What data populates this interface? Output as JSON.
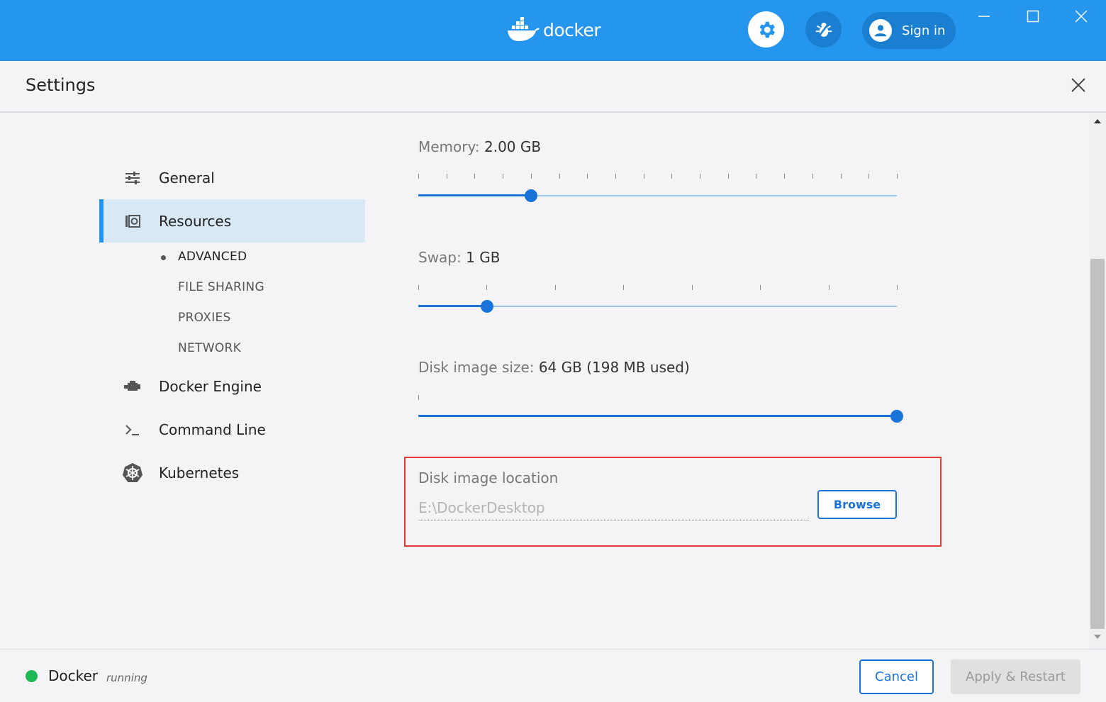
{
  "titlebar": {
    "brand": "docker",
    "signin_label": "Sign in",
    "accent_color": "#2496ed"
  },
  "settings": {
    "title": "Settings"
  },
  "sidebar": {
    "items": [
      {
        "label": "General",
        "icon": "sliders-icon"
      },
      {
        "label": "Resources",
        "icon": "resources-icon",
        "active": true
      },
      {
        "label": "Docker Engine",
        "icon": "engine-icon"
      },
      {
        "label": "Command Line",
        "icon": "terminal-icon"
      },
      {
        "label": "Kubernetes",
        "icon": "kubernetes-icon"
      }
    ],
    "subitems": [
      {
        "label": "ADVANCED",
        "active": true
      },
      {
        "label": "FILE SHARING"
      },
      {
        "label": "PROXIES"
      },
      {
        "label": "NETWORK"
      }
    ]
  },
  "resources": {
    "memory": {
      "label": "Memory: ",
      "value": "2.00 GB",
      "level": 0.235
    },
    "swap": {
      "label": "Swap: ",
      "value": "1 GB",
      "level": 0.143
    },
    "disk_size": {
      "label": "Disk image size: ",
      "value": "64 GB (198 MB used)",
      "level": 1.0
    },
    "disk_location": {
      "label": "Disk image location",
      "value": "E:\\DockerDesktop",
      "browse_label": "Browse"
    }
  },
  "footer": {
    "status_name": "Docker",
    "status_state": "running",
    "status_color": "#1db954",
    "cancel_label": "Cancel",
    "apply_label": "Apply & Restart"
  }
}
